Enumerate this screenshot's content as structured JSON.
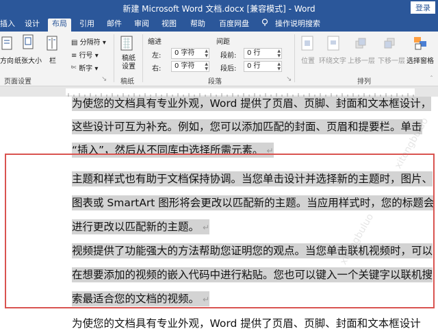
{
  "window": {
    "title": "新建 Microsoft Word 文档.docx [兼容模式] - Word",
    "login_label": "登录"
  },
  "tabs": [
    "插入",
    "设计",
    "布局",
    "引用",
    "邮件",
    "审阅",
    "视图",
    "帮助",
    "百度网盘",
    "操作说明搜索"
  ],
  "active_tab": "布局",
  "ribbon": {
    "page_setup": {
      "orientation": "方向",
      "size": "纸张大小",
      "columns": "栏",
      "breaks": "分隔符",
      "line_numbers": "行号",
      "hyphenation": "断字",
      "group_label": "页面设置"
    },
    "manuscript": {
      "settings": "稿纸设置",
      "group_label": "稿纸"
    },
    "indent": {
      "label": "缩进",
      "left_label": "左:",
      "left_value": "0 字符",
      "right_label": "右:",
      "right_value": "0 字符"
    },
    "spacing": {
      "label": "间距",
      "before_label": "段前:",
      "before_value": "0 行",
      "after_label": "段后:",
      "after_value": "0 行"
    },
    "paragraph_group_label": "段落",
    "arrange": {
      "position": "位置",
      "wrap_text": "环绕文字",
      "bring_forward": "上移一层",
      "send_backward": "下移一层",
      "selection_pane": "选择窗格",
      "group_label": "排列"
    }
  },
  "document": {
    "lines": [
      "为使您的文档具有专业外观，Word 提供了页眉、页脚、封面和文本框设计，",
      "这些设计可互为补充。例如，您可以添加匹配的封面、页眉和提要栏。单击",
      "“插入”，然后从不同库中选择所需元素。",
      "主题和样式也有助于文档保持协调。当您单击设计并选择新的主题时，图片、",
      "图表或 SmartArt 图形将会更改以匹配新的主题。当应用样式时，您的标题会",
      "进行更改以匹配新的主题。",
      "视频提供了功能强大的方法帮助您证明您的观点。当您单击联机视频时，可以",
      "在想要添加的视频的嵌入代码中进行粘贴。您也可以键入一个关键字以联机搜",
      "索最适合您的文档的视频。",
      "为使您的文档具有专业外观，Word 提供了页眉、页脚、封面和文本框设计"
    ],
    "paragraph_mark": "↵"
  },
  "colors": {
    "title_bar": "#2b579a",
    "ribbon": "#f3f3f3",
    "selection": "#d3d3d3",
    "annotation_box": "#d9534f"
  }
}
